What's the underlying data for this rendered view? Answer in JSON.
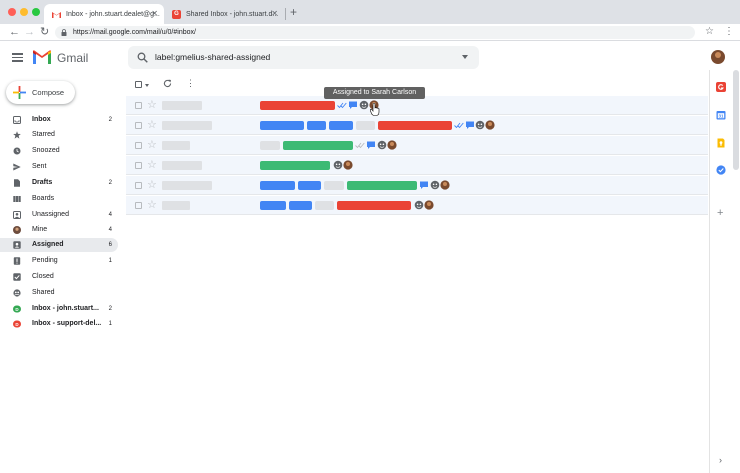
{
  "browser": {
    "tabs": [
      {
        "title": "Inbox - john.stuart.dealet@g...",
        "active": true,
        "favicon": "gmail-icon"
      },
      {
        "title": "Shared Inbox - john.stuart.d...",
        "active": false,
        "favicon": "gmelius-icon"
      }
    ],
    "url": "https://mail.google.com/mail/u/0/#inbox/",
    "colors": {
      "traffic_red": "#ff5f57",
      "traffic_yellow": "#febc2e",
      "traffic_green": "#28c840"
    }
  },
  "header": {
    "app_name": "Gmail",
    "search_value": "label:gmelius-shared-assigned"
  },
  "compose": {
    "label": "Compose"
  },
  "sidebar": {
    "items": [
      {
        "label": "Inbox",
        "count": "2",
        "icon": "inbox-icon",
        "bold": true
      },
      {
        "label": "Starred",
        "count": "",
        "icon": "star-icon"
      },
      {
        "label": "Snoozed",
        "count": "",
        "icon": "clock-icon"
      },
      {
        "label": "Sent",
        "count": "",
        "icon": "send-icon"
      },
      {
        "label": "Drafts",
        "count": "2",
        "icon": "draft-icon",
        "bold": true
      },
      {
        "label": "Boards",
        "count": "",
        "icon": "boards-icon"
      },
      {
        "label": "Unassigned",
        "count": "4",
        "icon": "unassigned-icon"
      },
      {
        "label": "Mine",
        "count": "4",
        "icon": "mine-avatar-icon"
      },
      {
        "label": "Assigned",
        "count": "6",
        "icon": "assigned-icon",
        "active": true
      },
      {
        "label": "Pending",
        "count": "1",
        "icon": "pending-icon"
      },
      {
        "label": "Closed",
        "count": "",
        "icon": "closed-check-icon"
      },
      {
        "label": "Shared",
        "count": "",
        "icon": "shared-icon"
      },
      {
        "label": "Inbox - john.stuart...",
        "count": "2",
        "icon": "shared-inbox-green-icon",
        "bold": true
      },
      {
        "label": "Inbox - support-del...",
        "count": "1",
        "icon": "shared-inbox-red-icon",
        "bold": true
      }
    ]
  },
  "list": {
    "tooltip": "Assigned to Sarah Carlson",
    "colors": {
      "red": "#ea4335",
      "blue": "#4285f4",
      "green": "#3cba74",
      "gray": "#dfe1e4",
      "row_bg": "#f2f6fc"
    }
  },
  "right_rail": {
    "icons": [
      "gmelius-icon",
      "calendar-icon",
      "keep-icon",
      "tasks-icon",
      "add-icon"
    ]
  }
}
